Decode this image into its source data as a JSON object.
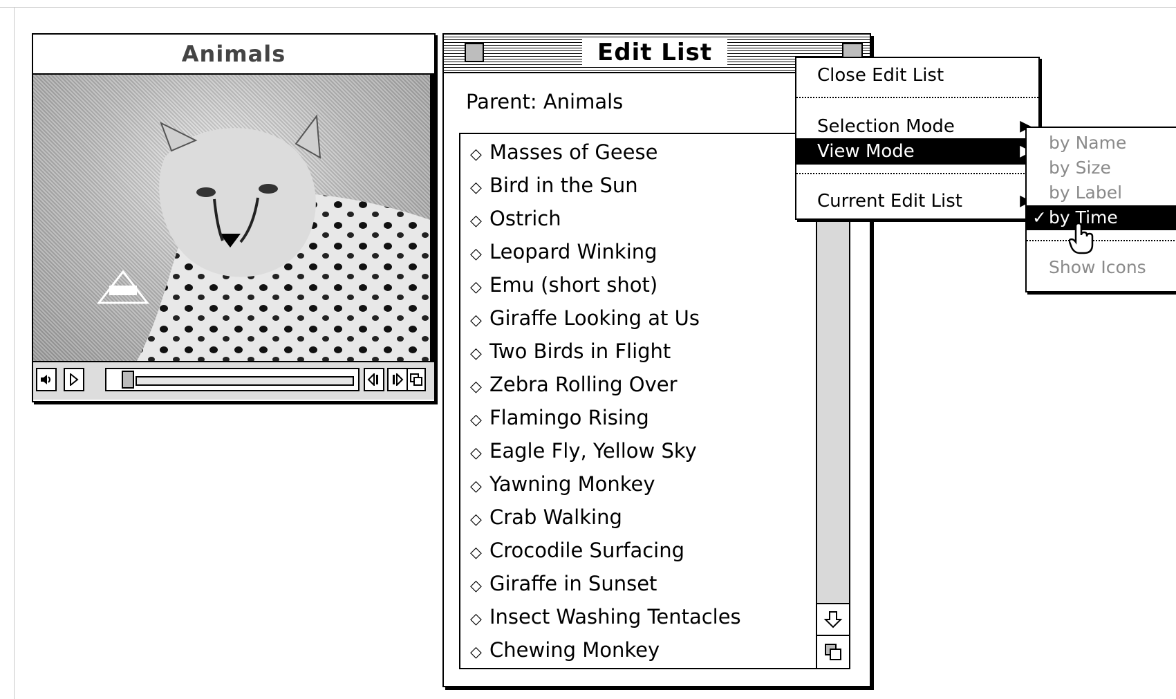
{
  "movie_window": {
    "title": "Animals"
  },
  "edit_list": {
    "title": "Edit List",
    "parent_label": "Parent: Animals",
    "items": [
      "Masses of Geese",
      "Bird in the Sun",
      "Ostrich",
      "Leopard Winking",
      "Emu (short shot)",
      "Giraffe Looking at Us",
      "Two Birds in Flight",
      "Zebra Rolling Over",
      "Flamingo Rising",
      "Eagle Fly, Yellow Sky",
      "Yawning Monkey",
      "Crab Walking",
      "Crocodile Surfacing",
      "Giraffe in Sunset",
      "Insect Washing Tentacles",
      "Chewing Monkey"
    ],
    "item_bullet": "◇"
  },
  "popup_menu": {
    "close": "Close Edit List",
    "selection_mode": "Selection Mode",
    "view_mode": "View Mode",
    "current_edit_list": "Current Edit List",
    "submenu_arrow": "▶"
  },
  "view_mode_submenu": {
    "by_name": "by Name",
    "by_size": "by Size",
    "by_label": "by Label",
    "by_time": "by Time",
    "show_icons": "Show Icons",
    "check": "✓"
  },
  "icons": {
    "speaker": "speaker-icon",
    "play": "play-icon",
    "step_back": "step-back-icon",
    "step_forward": "step-forward-icon",
    "scroll_down": "scroll-down-arrow-icon",
    "grow": "grow-box-icon",
    "cursor": "hand-cursor-icon"
  },
  "colors": {
    "selection_bg": "#000000",
    "disabled_text": "#8a8a8a"
  }
}
